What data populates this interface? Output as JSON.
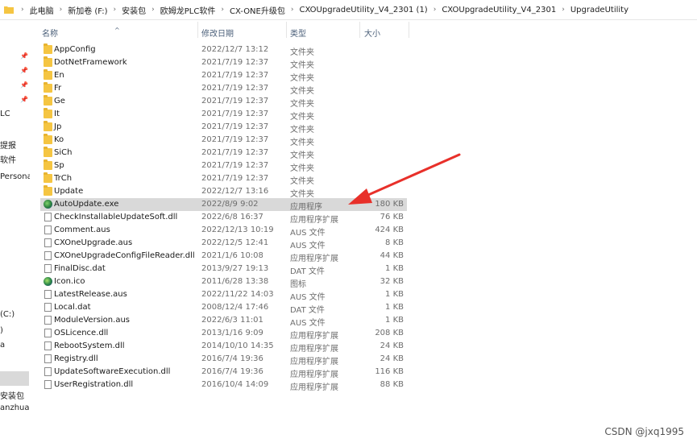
{
  "address": {
    "breadcrumbs": [
      "此电脑",
      "新加卷 (F:)",
      "安装包",
      "欧姆龙PLC软件",
      "CX-ONE升级包",
      "CXOUpgradeUtility_V4_2301 (1)",
      "CXOUpgradeUtility_V4_2301",
      "UpgradeUtility"
    ]
  },
  "nav": {
    "labels": [
      "LC",
      "提报",
      "软件",
      "Persona",
      "(C:)",
      ")",
      "a",
      "安装包",
      "anzhuan"
    ]
  },
  "columns": {
    "name": "名称",
    "date": "修改日期",
    "type": "类型",
    "size": "大小"
  },
  "files": [
    {
      "icon": "folder-icon",
      "name": "AppConfig",
      "date": "2022/12/7 13:12",
      "type": "文件夹",
      "size": ""
    },
    {
      "icon": "folder-icon",
      "name": "DotNetFramework",
      "date": "2021/7/19 12:37",
      "type": "文件夹",
      "size": ""
    },
    {
      "icon": "folder-icon",
      "name": "En",
      "date": "2021/7/19 12:37",
      "type": "文件夹",
      "size": ""
    },
    {
      "icon": "folder-icon",
      "name": "Fr",
      "date": "2021/7/19 12:37",
      "type": "文件夹",
      "size": ""
    },
    {
      "icon": "folder-icon",
      "name": "Ge",
      "date": "2021/7/19 12:37",
      "type": "文件夹",
      "size": ""
    },
    {
      "icon": "folder-icon",
      "name": "It",
      "date": "2021/7/19 12:37",
      "type": "文件夹",
      "size": ""
    },
    {
      "icon": "folder-icon",
      "name": "Jp",
      "date": "2021/7/19 12:37",
      "type": "文件夹",
      "size": ""
    },
    {
      "icon": "folder-icon",
      "name": "Ko",
      "date": "2021/7/19 12:37",
      "type": "文件夹",
      "size": ""
    },
    {
      "icon": "folder-icon",
      "name": "SiCh",
      "date": "2021/7/19 12:37",
      "type": "文件夹",
      "size": ""
    },
    {
      "icon": "folder-icon",
      "name": "Sp",
      "date": "2021/7/19 12:37",
      "type": "文件夹",
      "size": ""
    },
    {
      "icon": "folder-icon",
      "name": "TrCh",
      "date": "2021/7/19 12:37",
      "type": "文件夹",
      "size": ""
    },
    {
      "icon": "folder-icon",
      "name": "Update",
      "date": "2022/12/7 13:16",
      "type": "文件夹",
      "size": ""
    },
    {
      "icon": "exe-icon",
      "name": "AutoUpdate.exe",
      "date": "2022/8/9 9:02",
      "type": "应用程序",
      "size": "180 KB",
      "selected": true
    },
    {
      "icon": "file-icon",
      "name": "CheckInstallableUpdateSoft.dll",
      "date": "2022/6/8 16:37",
      "type": "应用程序扩展",
      "size": "76 KB"
    },
    {
      "icon": "file-icon",
      "name": "Comment.aus",
      "date": "2022/12/13 10:19",
      "type": "AUS 文件",
      "size": "424 KB"
    },
    {
      "icon": "file-icon",
      "name": "CXOneUpgrade.aus",
      "date": "2022/12/5 12:41",
      "type": "AUS 文件",
      "size": "8 KB"
    },
    {
      "icon": "file-icon",
      "name": "CXOneUpgradeConfigFileReader.dll",
      "date": "2021/1/6 10:08",
      "type": "应用程序扩展",
      "size": "44 KB"
    },
    {
      "icon": "file-icon",
      "name": "FinalDisc.dat",
      "date": "2013/9/27 19:13",
      "type": "DAT 文件",
      "size": "1 KB"
    },
    {
      "icon": "ico-icon",
      "name": "Icon.ico",
      "date": "2011/6/28 13:38",
      "type": "图标",
      "size": "32 KB"
    },
    {
      "icon": "file-icon",
      "name": "LatestRelease.aus",
      "date": "2022/11/22 14:03",
      "type": "AUS 文件",
      "size": "1 KB"
    },
    {
      "icon": "file-icon",
      "name": "Local.dat",
      "date": "2008/12/4 17:46",
      "type": "DAT 文件",
      "size": "1 KB"
    },
    {
      "icon": "file-icon",
      "name": "ModuleVersion.aus",
      "date": "2022/6/3 11:01",
      "type": "AUS 文件",
      "size": "1 KB"
    },
    {
      "icon": "file-icon",
      "name": "OSLicence.dll",
      "date": "2013/1/16 9:09",
      "type": "应用程序扩展",
      "size": "208 KB"
    },
    {
      "icon": "file-icon",
      "name": "RebootSystem.dll",
      "date": "2014/10/10 14:35",
      "type": "应用程序扩展",
      "size": "24 KB"
    },
    {
      "icon": "file-icon",
      "name": "Registry.dll",
      "date": "2016/7/4 19:36",
      "type": "应用程序扩展",
      "size": "24 KB"
    },
    {
      "icon": "file-icon",
      "name": "UpdateSoftwareExecution.dll",
      "date": "2016/7/4 19:36",
      "type": "应用程序扩展",
      "size": "116 KB"
    },
    {
      "icon": "file-icon",
      "name": "UserRegistration.dll",
      "date": "2016/10/4 14:09",
      "type": "应用程序扩展",
      "size": "88 KB"
    }
  ],
  "annotation": {
    "color": "#e8302a"
  },
  "watermark": "CSDN @jxq1995"
}
